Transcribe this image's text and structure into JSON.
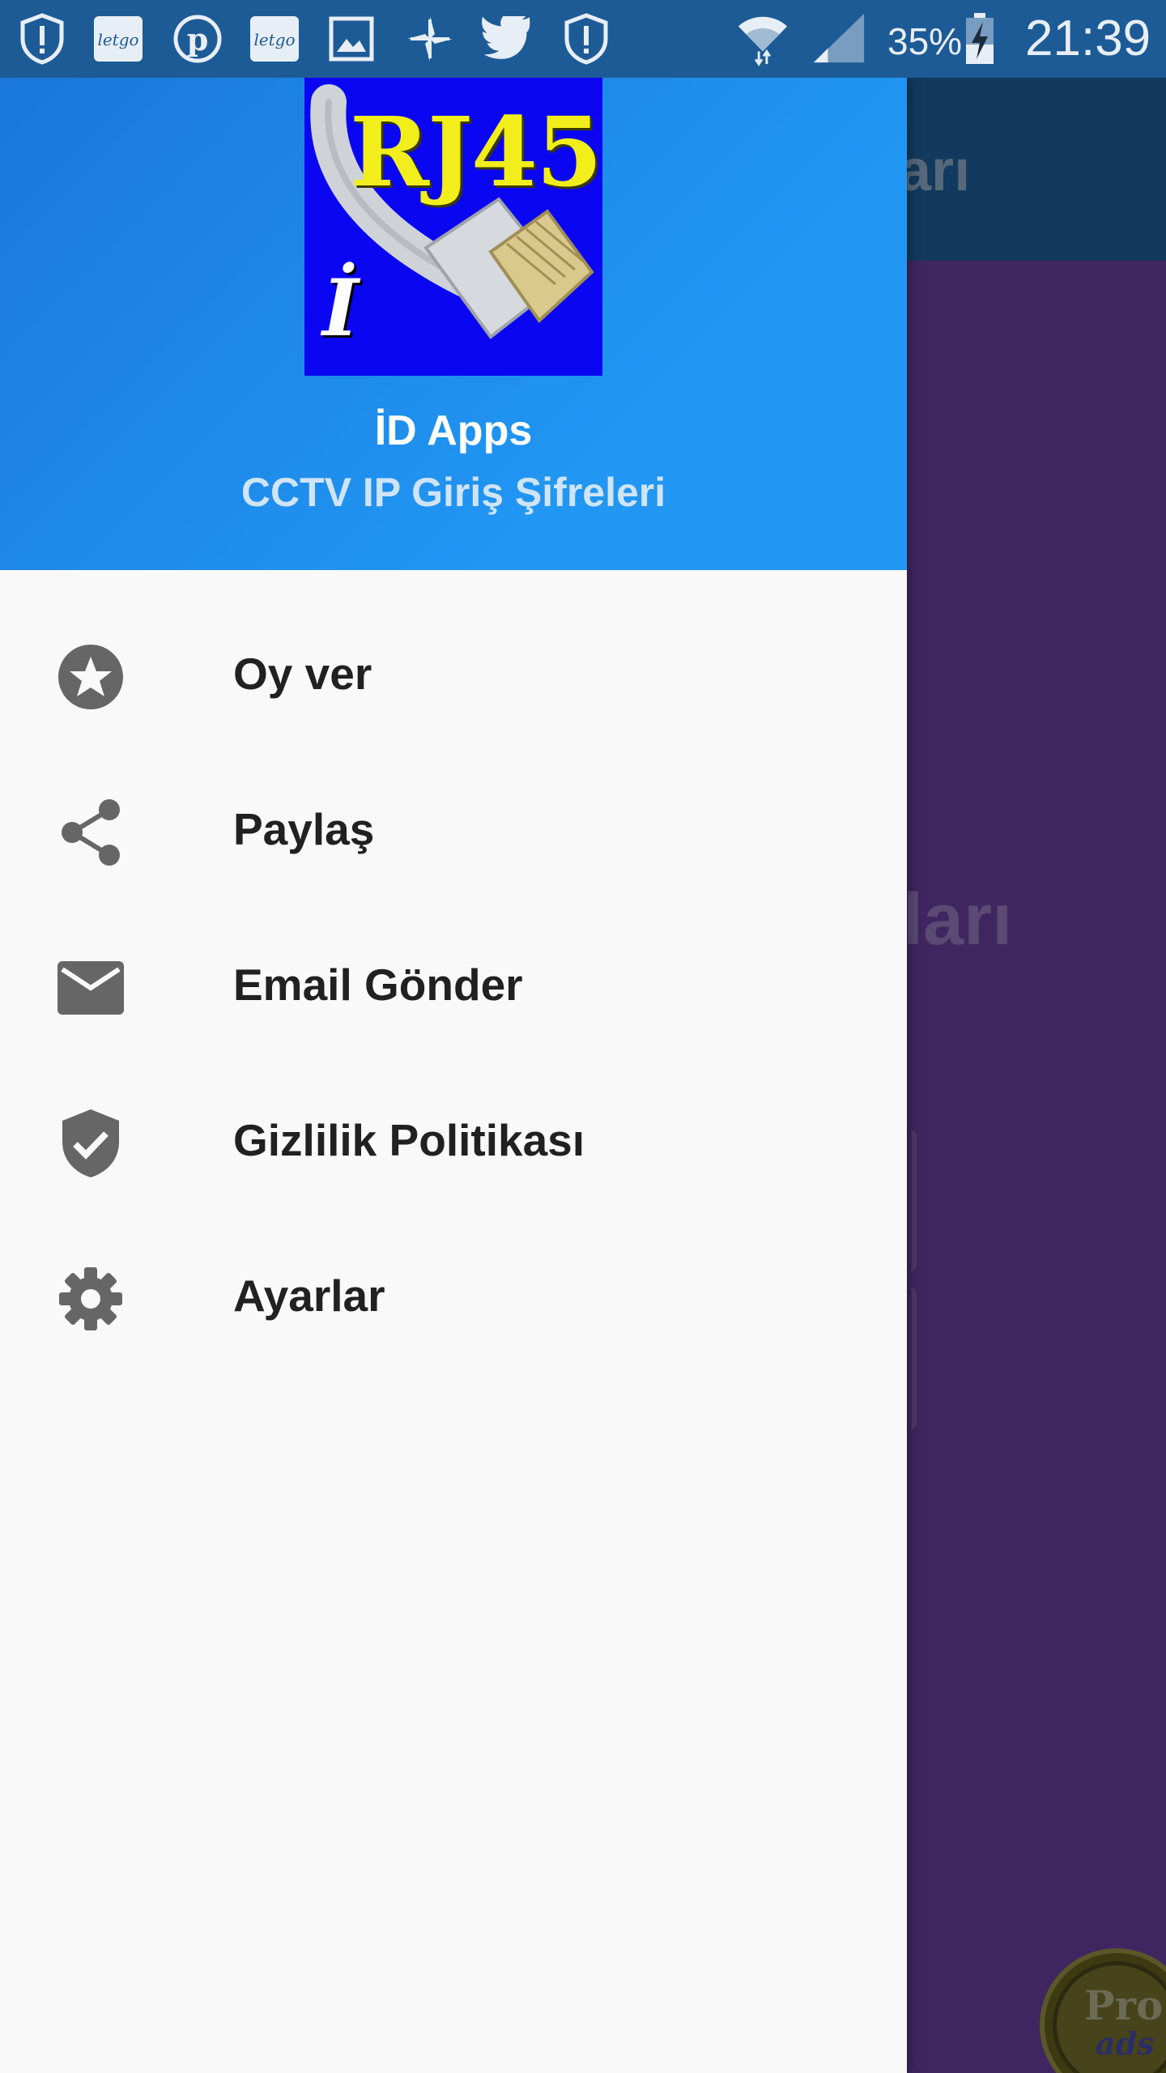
{
  "status_bar": {
    "notification_icons": [
      "alert-shield-icon",
      "letgo-icon",
      "pinterest-icon",
      "letgo-icon",
      "image-icon",
      "pinwheel-icon",
      "twitter-icon",
      "alert-shield-icon"
    ],
    "battery_percent": "35%",
    "time": "21:39"
  },
  "drawer": {
    "logo": {
      "title": "RJ45",
      "letter": "İ"
    },
    "app_name": "İD Apps",
    "app_subtitle": "CCTV IP Giriş Şifreleri",
    "menu": [
      {
        "label": "Oy ver",
        "icon": "star-circle-icon"
      },
      {
        "label": "Paylaş",
        "icon": "share-icon"
      },
      {
        "label": "Email Gönder",
        "icon": "email-icon"
      },
      {
        "label": "Gizlilik Politikası",
        "icon": "shield-check-icon"
      },
      {
        "label": "Ayarlar",
        "icon": "gear-icon"
      }
    ]
  },
  "background_app": {
    "title_fragment": "arı",
    "heading_fragment": "ları",
    "ad_badge": {
      "line1": "Pro",
      "line2": "ads"
    }
  },
  "colors": {
    "status_bar": "#1d5b96",
    "drawer_header": "#2196f3",
    "drawer_body": "#f9f9fa",
    "background": "#402660",
    "icon_gray": "#666666"
  }
}
